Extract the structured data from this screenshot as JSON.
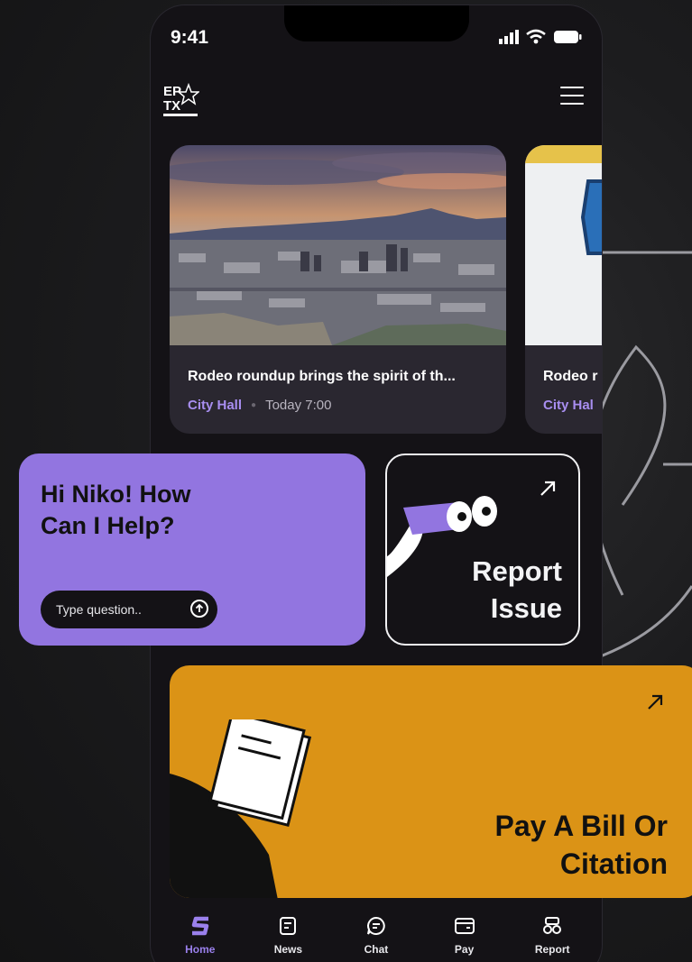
{
  "status_bar": {
    "time": "9:41"
  },
  "header": {
    "logo_text": "EP TX"
  },
  "news": [
    {
      "title": "Rodeo roundup brings the spirit of th...",
      "category": "City Hall",
      "time": "Today 7:00"
    },
    {
      "title": "Rodeo r",
      "category": "City Hal",
      "time": ""
    }
  ],
  "help": {
    "greeting": "Hi Niko! How Can I Help?",
    "placeholder": "Type question.."
  },
  "report": {
    "label": "Report Issue"
  },
  "pay": {
    "label": "Pay A Bill Or Citation"
  },
  "tabs": [
    {
      "label": "Home",
      "icon": "home-s-icon",
      "active": true
    },
    {
      "label": "News",
      "icon": "news-icon"
    },
    {
      "label": "Chat",
      "icon": "chat-icon"
    },
    {
      "label": "Pay",
      "icon": "wallet-icon"
    },
    {
      "label": "Report",
      "icon": "binoculars-icon"
    }
  ],
  "colors": {
    "accent_purple": "#9275e0",
    "accent_orange": "#db9316",
    "background": "#141216"
  }
}
